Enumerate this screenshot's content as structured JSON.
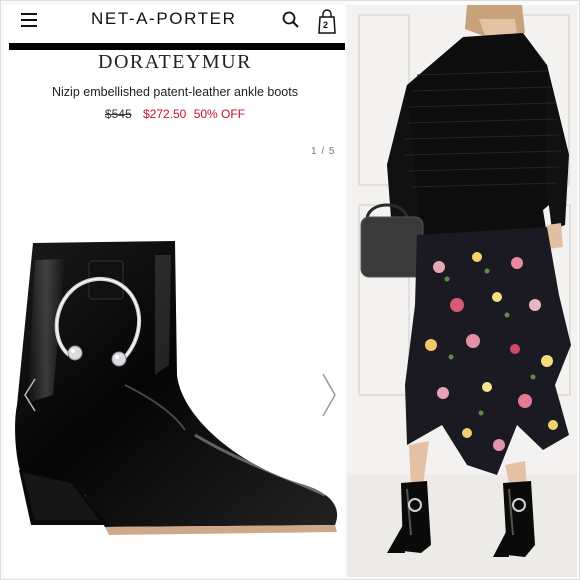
{
  "header": {
    "brand": "NET-A-PORTER",
    "bag_count": "2"
  },
  "product": {
    "designer": "DORATEYMUR",
    "name": "Nizip embellished patent-leather ankle boots",
    "original_price": "$545",
    "sale_price": "$272.50",
    "discount": "50% OFF"
  },
  "gallery": {
    "page_indicator": "1 / 5"
  },
  "colors": {
    "sale_red": "#c8102e",
    "header_bar": "#000000",
    "boot_patent": "#0b0b0b"
  },
  "icons": [
    "menu-icon",
    "search-icon",
    "shopping-bag-icon",
    "chevron-left-icon",
    "chevron-right-icon"
  ]
}
